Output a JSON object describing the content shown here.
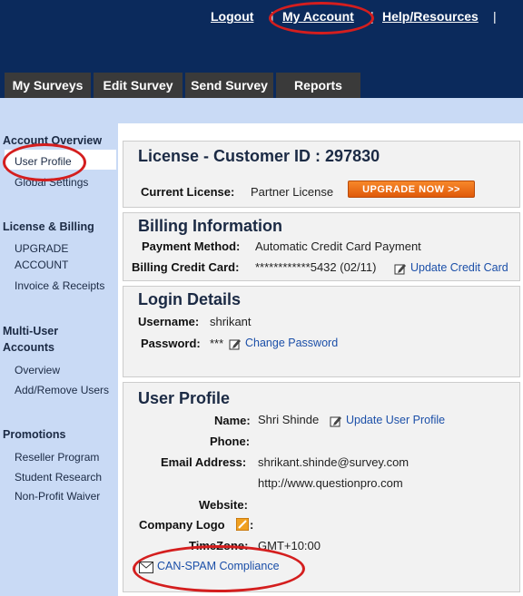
{
  "header": {
    "links": {
      "logout": "Logout",
      "my_account": "My Account",
      "help": "Help/Resources",
      "divider": "|"
    },
    "tabs": [
      "My Surveys",
      "Edit Survey",
      "Send Survey",
      "Reports"
    ]
  },
  "sidebar": {
    "account_overview": {
      "heading": "Account Overview",
      "items": [
        "User Profile",
        "Global Settings"
      ]
    },
    "license_billing": {
      "heading": "License & Billing",
      "items": [
        "UPGRADE",
        "ACCOUNT",
        "Invoice & Receipts"
      ]
    },
    "multi_user": {
      "heading_line1": "Multi-User",
      "heading_line2": "Accounts",
      "items": [
        "Overview",
        "Add/Remove Users"
      ]
    },
    "promotions": {
      "heading": "Promotions",
      "items": [
        "Reseller Program",
        "Student Research",
        "Non-Profit Waiver"
      ]
    }
  },
  "license": {
    "title": "License - Customer ID : 297830",
    "current_label": "Current License:",
    "current_value": "Partner License",
    "upgrade_button": "UPGRADE NOW >>"
  },
  "billing": {
    "title": "Billing Information",
    "method_label": "Payment Method:",
    "method_value": "Automatic Credit Card Payment",
    "card_label": "Billing Credit Card:",
    "card_value": "************5432 (02/11)",
    "update_link": "Update Credit Card"
  },
  "login": {
    "title": "Login Details",
    "username_label": "Username:",
    "username_value": "shrikant",
    "password_label": "Password:",
    "password_value": "***",
    "change_link": "Change Password"
  },
  "profile": {
    "title": "User Profile",
    "name_label": "Name:",
    "name_value": "Shri Shinde",
    "update_link": "Update User Profile",
    "phone_label": "Phone:",
    "email_label": "Email Address:",
    "email_value": "shrikant.shinde@survey.com",
    "url_value": "http://www.questionpro.com",
    "website_label": "Website:",
    "logo_label": "Company Logo",
    "logo_colon": ":",
    "timezone_label": "TimeZone:",
    "timezone_value": "GMT+10:00",
    "spam_link": "CAN-SPAM Compliance"
  },
  "colors": {
    "header_bg": "#0b2a5c",
    "tab_bg": "#3a3a3a",
    "sidebar_bg": "#c9daf5",
    "link": "#1b4fa8",
    "highlight_ring": "#d41e1e",
    "upgrade_orange": "#e05a0a"
  },
  "icons": [
    "edit-pencil-icon",
    "edit-pencil-icon",
    "edit-pencil-icon",
    "logo-image-icon",
    "envelope-icon"
  ]
}
